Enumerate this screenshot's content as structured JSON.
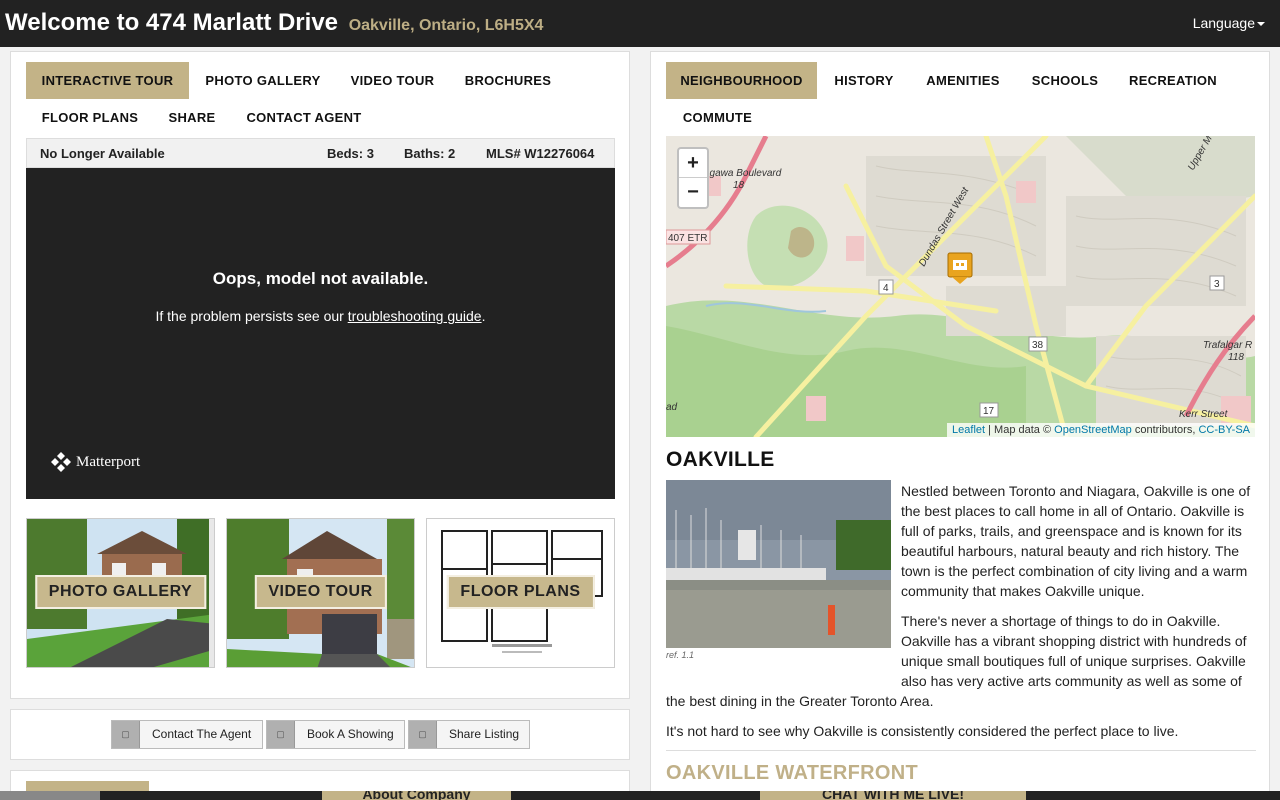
{
  "header": {
    "title": "Welcome to 474 Marlatt Drive",
    "subtitle": "Oakville, Ontario, L6H5X4",
    "language_label": "Language"
  },
  "left_tabs": [
    {
      "label": "INTERACTIVE TOUR",
      "active": true
    },
    {
      "label": "PHOTO GALLERY",
      "active": false
    },
    {
      "label": "VIDEO TOUR",
      "active": false
    },
    {
      "label": "BROCHURES",
      "active": false
    },
    {
      "label": "FLOOR PLANS",
      "active": false
    },
    {
      "label": "SHARE",
      "active": false
    },
    {
      "label": "CONTACT AGENT",
      "active": false
    }
  ],
  "listing": {
    "status": "No Longer Available",
    "beds": "Beds: 3",
    "baths": "Baths: 2",
    "mls": "MLS# W12276064"
  },
  "tour": {
    "error_title": "Oops, model not available.",
    "error_prefix": "If the problem persists see our ",
    "error_link": "troubleshooting guide",
    "error_suffix": ".",
    "brand": "Matterport"
  },
  "thumbnails": [
    {
      "label": "PHOTO GALLERY"
    },
    {
      "label": "VIDEO TOUR"
    },
    {
      "label": "FLOOR PLANS"
    }
  ],
  "actions": [
    {
      "label": "Contact The Agent",
      "icon": "envelope-icon"
    },
    {
      "label": "Book A Showing",
      "icon": "calendar-icon"
    },
    {
      "label": "Share Listing",
      "icon": "share-icon"
    }
  ],
  "right_tabs": [
    {
      "label": "NEIGHBOURHOOD",
      "active": true
    },
    {
      "label": "HISTORY",
      "active": false
    },
    {
      "label": "AMENITIES",
      "active": false
    },
    {
      "label": "SCHOOLS",
      "active": false
    },
    {
      "label": "RECREATION",
      "active": false
    },
    {
      "label": "COMMUTE",
      "active": false
    }
  ],
  "map": {
    "zoom_in": "+",
    "zoom_out": "−",
    "labels": {
      "niagara": "agawa Boulevard",
      "niagara_num": "18",
      "etr": "407 ETR",
      "dundas": "Dundas Street West",
      "upper": "Upper M",
      "trafalgar": "Trafalgar R",
      "trafalgar_num": "118",
      "kerr": "Kerr Street",
      "road4": "4",
      "road3": "3",
      "road38": "38",
      "road17": "17",
      "ad": "ad"
    },
    "attribution": {
      "leaflet": "Leaflet",
      "mid": " | Map data © ",
      "osm": "OpenStreetMap",
      "contrib": " contributors, ",
      "license": "CC-BY-SA"
    }
  },
  "neighbourhood": {
    "city": "OAKVILLE",
    "image_ref": "ref. 1.1",
    "p1": "Nestled between Toronto and Niagara, Oakville is one of the best places to call home in all of Ontario. Oakville is full of parks, trails, and greenspace and is known for its beautiful harbours, natural beauty and rich history. The town is the perfect combination of city living and a warm community that makes Oakville unique.",
    "p2a": "There's never a shortage of things to do in Oakville. Oakville has a vibrant shopping district with hundreds of unique small boutiques full of unique surprises. Oakville also has very active arts community as well as some of",
    "p2b": "the best dining in the Greater Toronto Area.",
    "p3": "It's not hard to see why Oakville is consistently considered the perfect place to live.",
    "next_heading": "OAKVILLE WATERFRONT"
  },
  "bottom_bar": {
    "tab1": "About Company",
    "tab2": "CHAT WITH ME LIVE!"
  },
  "colors": {
    "accent": "#c3b387",
    "header_bg": "#222222",
    "viewer_bg": "#222222",
    "subtitle": "#bdae85"
  }
}
